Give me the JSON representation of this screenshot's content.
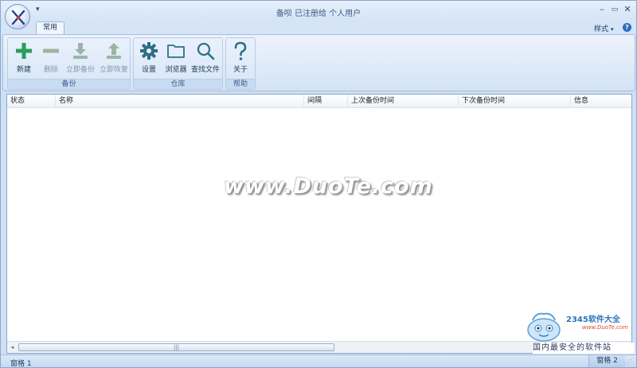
{
  "titlebar": {
    "title": "备呗  已注册给  个人用户",
    "qat_arrow": "▾",
    "minimize": "–",
    "maximize": "▭",
    "close": "✕"
  },
  "tabs": [
    {
      "label": "常用"
    }
  ],
  "style_menu": {
    "label": "样式",
    "caret": "▾"
  },
  "help_glyph": "?",
  "ribbon": {
    "groups": [
      {
        "label": "备份",
        "buttons": [
          {
            "label": "新建",
            "icon": "plus-icon",
            "enabled": true
          },
          {
            "label": "删除",
            "icon": "minus-icon",
            "enabled": false
          },
          {
            "label": "立即备份",
            "icon": "download-icon",
            "enabled": false
          },
          {
            "label": "立即恢复",
            "icon": "upload-icon",
            "enabled": false
          }
        ]
      },
      {
        "label": "仓库",
        "buttons": [
          {
            "label": "设置",
            "icon": "gear-icon",
            "enabled": true
          },
          {
            "label": "浏览器",
            "icon": "folder-icon",
            "enabled": true
          },
          {
            "label": "查找文件",
            "icon": "search-icon",
            "enabled": true
          }
        ]
      },
      {
        "label": "帮助",
        "buttons": [
          {
            "label": "关于",
            "icon": "question-icon",
            "enabled": true
          }
        ]
      }
    ]
  },
  "list": {
    "columns": [
      "状态",
      "名称",
      "间隔",
      "上次备份时间",
      "下次备份时间",
      "信息"
    ],
    "rows": []
  },
  "watermark": "www.DuoTe.com",
  "hscroll": {
    "left_arrow": "◂",
    "grip": "|||",
    "right_arrow": "▸"
  },
  "corner_logo": {
    "brand": "2345软件大全",
    "site": "www.DuoTe.com"
  },
  "bottom_caption": "国内最安全的软件站",
  "statusbar": {
    "left": "窗格 1",
    "right": "窗格 2",
    "grip": "⋰"
  },
  "colors": {
    "ribbon_bg": "#dbe8f7",
    "accent_green": "#2a9d5c",
    "accent_teal": "#2e6f86",
    "disabled": "#9bb5a4"
  }
}
